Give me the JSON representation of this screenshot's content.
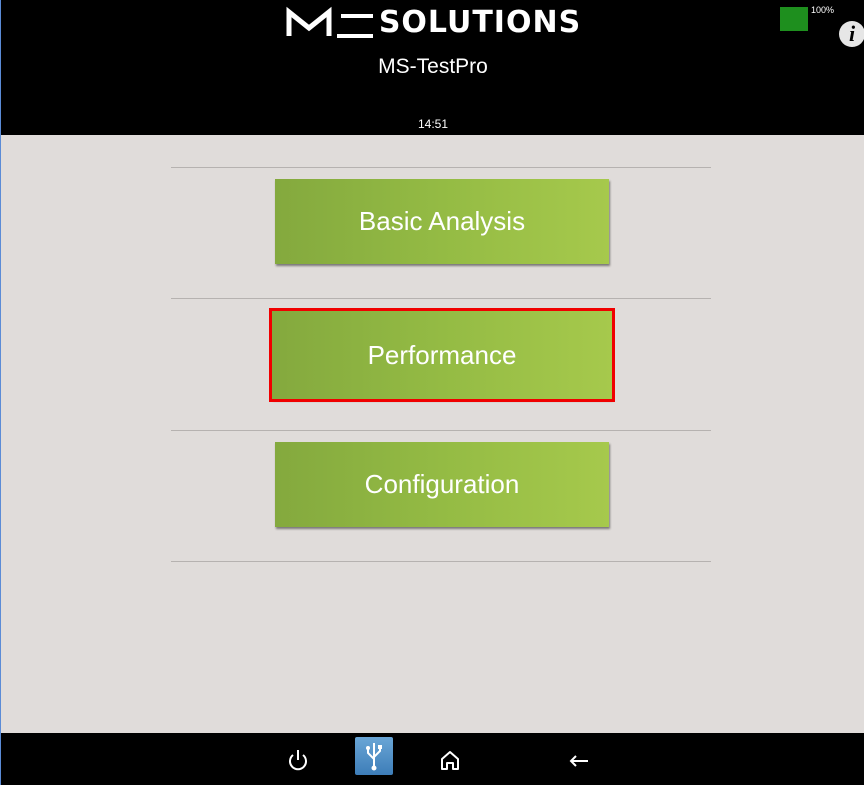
{
  "header": {
    "logo_text": "SOLUTIONS",
    "app_name": "MS-TestPro",
    "clock": "14:51",
    "battery": {
      "label": "100%",
      "color": "#1e8f1e"
    },
    "info_icon": "i"
  },
  "menu": {
    "items": [
      {
        "label": "Basic Analysis",
        "highlighted": false
      },
      {
        "label": "Performance",
        "highlighted": true
      },
      {
        "label": "Configuration",
        "highlighted": false
      }
    ],
    "accent_color": "#94bb44",
    "highlight_color": "#f00000"
  },
  "footer": {
    "icons": [
      "power-icon",
      "usb-icon",
      "home-icon",
      "back-icon"
    ]
  }
}
